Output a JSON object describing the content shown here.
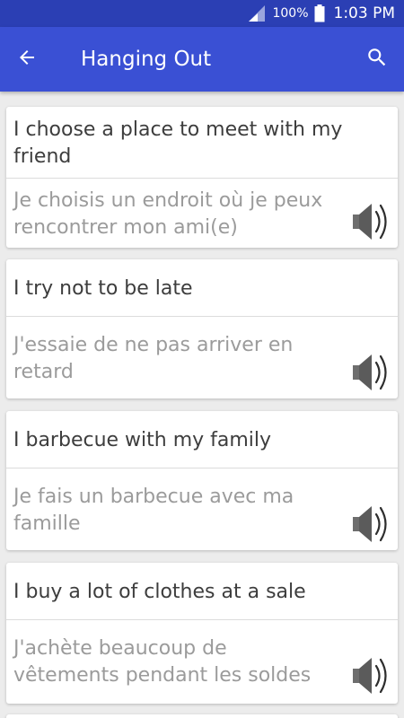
{
  "status_bar": {
    "battery_percent": "100%",
    "time": "1:03 PM",
    "icons": [
      "signal-icon",
      "battery-icon"
    ]
  },
  "app_bar": {
    "title": "Hanging Out",
    "icons": [
      "back-arrow-icon",
      "search-icon"
    ]
  },
  "phrases": [
    {
      "english": "I choose a place to meet with my friend",
      "french": "Je choisis un endroit où je peux rencontrer mon ami(e)"
    },
    {
      "english": "I try not to be late",
      "french": "J'essaie de ne pas arriver en retard"
    },
    {
      "english": "I barbecue with my family",
      "french": "Je fais un barbecue avec ma famille"
    },
    {
      "english": "I buy a lot of clothes at a sale",
      "french": "J'achète beaucoup de vêtements pendant les soldes"
    }
  ],
  "colors": {
    "status_bar": "#2b3fb4",
    "app_bar": "#3a50d4",
    "background": "#ececec",
    "card": "#ffffff",
    "english_text": "#3d3d3d",
    "french_text": "#9b9b9b",
    "speaker_icon": "#5b5b5b"
  }
}
